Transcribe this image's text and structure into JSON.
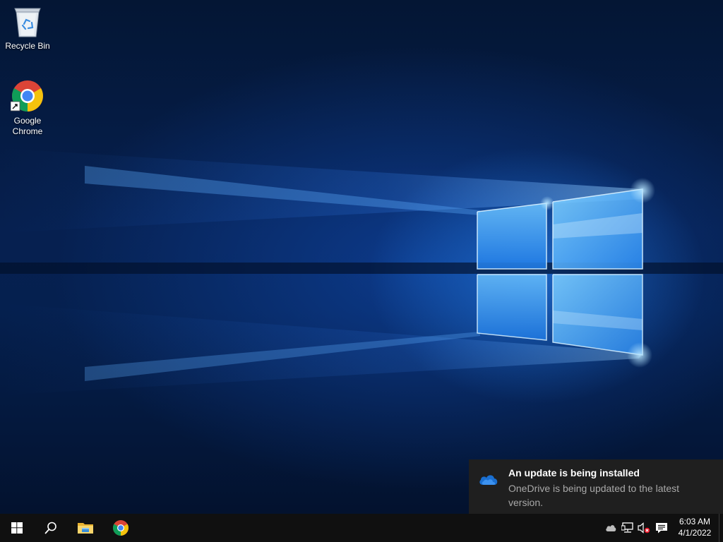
{
  "desktop": {
    "icons": [
      {
        "label": "Recycle Bin",
        "icon": "recycle-bin-icon"
      },
      {
        "label": "Google\nChrome",
        "icon": "chrome-icon"
      }
    ]
  },
  "notification": {
    "icon": "onedrive-cloud-icon",
    "title": "An update is being installed",
    "body": "OneDrive is being updated to the latest version."
  },
  "taskbar": {
    "pinned": [
      "start-icon",
      "search-icon",
      "file-explorer-icon",
      "chrome-icon"
    ],
    "tray": [
      "onedrive-cloud-icon",
      "network-icon",
      "volume-muted-icon",
      "action-center-icon"
    ],
    "clock": {
      "time": "6:03 AM",
      "date": "4/1/2022"
    }
  },
  "colors": {
    "taskbar_bg": "#101010",
    "toast_bg": "#1f1f1f",
    "accent": "#2f7cf6"
  }
}
